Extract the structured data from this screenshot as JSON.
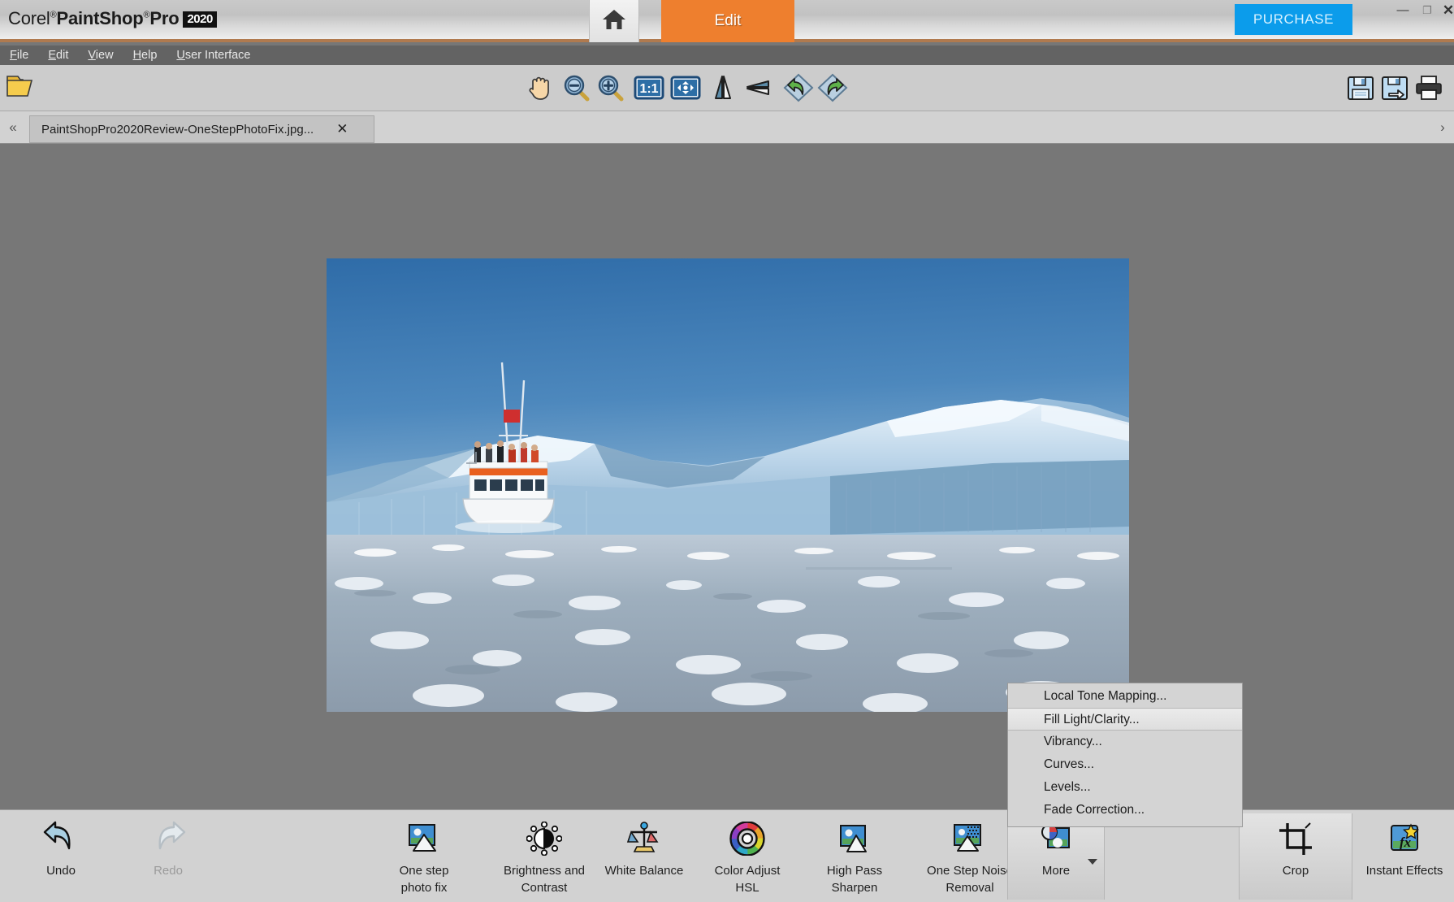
{
  "titlebar": {
    "brand_corel": "Corel",
    "brand_paintshop": "PaintShop",
    "brand_pro": "Pro",
    "brand_year": "2020",
    "home_icon": "home-icon",
    "edit_tab": "Edit",
    "purchase": "PURCHASE",
    "minimize": "—",
    "maximize": "❐",
    "close": "✕",
    "accent_orange": "#ee7f2e",
    "accent_blue": "#0b9ceb",
    "accent_brown": "#b07a4f"
  },
  "menubar": {
    "items": [
      {
        "pre": "F",
        "rest": "ile"
      },
      {
        "pre": "E",
        "rest": "dit"
      },
      {
        "pre": "V",
        "rest": "iew"
      },
      {
        "pre": "H",
        "rest": "elp"
      },
      {
        "pre": "U",
        "rest": "ser Interface"
      }
    ]
  },
  "toolbar": {
    "open_icon": "open-folder-icon",
    "tools": [
      {
        "name": "pan-hand-icon",
        "title": "Pan"
      },
      {
        "name": "zoom-out-icon",
        "title": "Zoom Out"
      },
      {
        "name": "zoom-in-icon",
        "title": "Zoom In"
      },
      {
        "name": "actual-size-1-1-icon",
        "title": "1:1"
      },
      {
        "name": "fit-to-window-icon",
        "title": "Fit to Window"
      },
      {
        "name": "mirror-icon",
        "title": "Mirror"
      },
      {
        "name": "flip-icon",
        "title": "Flip"
      },
      {
        "name": "undo-icon",
        "title": "Undo"
      },
      {
        "name": "redo-icon",
        "title": "Redo"
      }
    ],
    "right_tools": [
      {
        "name": "save-icon",
        "title": "Save"
      },
      {
        "name": "save-as-icon",
        "title": "Save As"
      },
      {
        "name": "print-icon",
        "title": "Print"
      }
    ]
  },
  "tabstrip": {
    "scroll_left": "«",
    "scroll_right": "›",
    "document_name": "PaintShopPro2020Review-OneStepPhotoFix.jpg...",
    "close_tab": "✕"
  },
  "canvas": {
    "background_color": "#777777",
    "photo_alt": "Arctic iceberg with tourist boat in ice-filled water"
  },
  "dropdown": {
    "items": [
      {
        "label": "Local Tone Mapping...",
        "selected": false
      },
      {
        "label": "Fill Light/Clarity...",
        "selected": true
      },
      {
        "label": "Vibrancy...",
        "selected": false
      },
      {
        "label": "Curves...",
        "selected": false
      },
      {
        "label": "Levels...",
        "selected": false
      },
      {
        "label": "Fade Correction...",
        "selected": false
      }
    ]
  },
  "bottombar": {
    "items": [
      {
        "label": "Undo",
        "icon": "undo-arrow-icon",
        "disabled": false,
        "active": false,
        "has_caret": false
      },
      {
        "label": "Redo",
        "icon": "redo-arrow-icon",
        "disabled": true,
        "active": false,
        "has_caret": false
      },
      {
        "label": "One step\nphoto fix",
        "icon": "one-step-photo-fix-icon",
        "disabled": false,
        "active": false,
        "has_caret": false
      },
      {
        "label": "Brightness and\nContrast",
        "icon": "brightness-contrast-icon",
        "disabled": false,
        "active": false,
        "has_caret": false
      },
      {
        "label": "White Balance",
        "icon": "white-balance-icon",
        "disabled": false,
        "active": false,
        "has_caret": false
      },
      {
        "label": "Color Adjust\nHSL",
        "icon": "color-adjust-hsl-icon",
        "disabled": false,
        "active": false,
        "has_caret": false
      },
      {
        "label": "High Pass\nSharpen",
        "icon": "high-pass-sharpen-icon",
        "disabled": false,
        "active": false,
        "has_caret": false
      },
      {
        "label": "One Step Noise\nRemoval",
        "icon": "one-step-noise-removal-icon",
        "disabled": false,
        "active": false,
        "has_caret": false
      },
      {
        "label": "More",
        "icon": "more-icon",
        "disabled": false,
        "active": true,
        "has_caret": true
      },
      {
        "label": "Crop",
        "icon": "crop-icon",
        "disabled": false,
        "active": true,
        "has_caret": false
      },
      {
        "label": "Instant Effects",
        "icon": "instant-effects-icon",
        "disabled": false,
        "active": false,
        "has_caret": false
      }
    ]
  }
}
